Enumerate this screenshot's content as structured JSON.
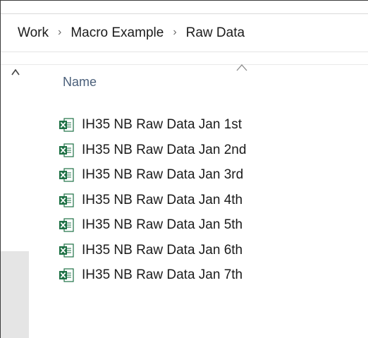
{
  "breadcrumb": {
    "items": [
      "Work",
      "Macro Example",
      "Raw Data"
    ],
    "separator": "›"
  },
  "file_list": {
    "column_header": "Name",
    "files": [
      {
        "name": "IH35 NB Raw Data Jan 1st",
        "icon": "excel-file-icon"
      },
      {
        "name": "IH35 NB Raw Data Jan 2nd",
        "icon": "excel-file-icon"
      },
      {
        "name": "IH35 NB Raw Data Jan 3rd",
        "icon": "excel-file-icon"
      },
      {
        "name": "IH35 NB Raw Data Jan 4th",
        "icon": "excel-file-icon"
      },
      {
        "name": "IH35 NB Raw Data Jan 5th",
        "icon": "excel-file-icon"
      },
      {
        "name": "IH35 NB Raw Data Jan 6th",
        "icon": "excel-file-icon"
      },
      {
        "name": "IH35 NB Raw Data Jan 7th",
        "icon": "excel-file-icon"
      }
    ]
  },
  "colors": {
    "excel_green": "#1e7145",
    "header_text": "#4a5f7a",
    "scroll_track": "#e5e5e5"
  }
}
